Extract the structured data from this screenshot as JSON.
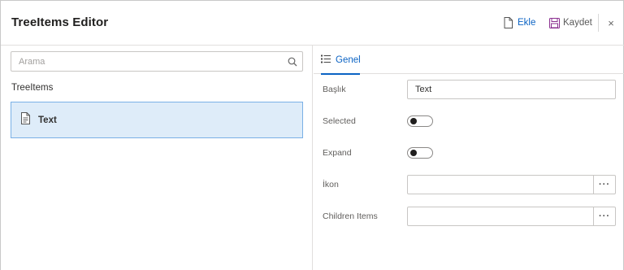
{
  "header": {
    "title": "TreeItems Editor",
    "add_label": "Ekle",
    "save_label": "Kaydet",
    "close_glyph": "×"
  },
  "left": {
    "search_placeholder": "Arama",
    "tree_title": "TreeItems",
    "items": [
      {
        "label": "Text",
        "icon": "document-icon",
        "selected": true
      }
    ]
  },
  "right": {
    "tab_label": "Genel",
    "fields": {
      "title_label": "Başlık",
      "title_value": "Text",
      "selected_label": "Selected",
      "selected_value": false,
      "expand_label": "Expand",
      "expand_value": false,
      "icon_label": "İkon",
      "icon_value": "",
      "children_label": "Children Items",
      "children_value": "",
      "picker_glyph": "···"
    }
  },
  "colors": {
    "accent": "#0b63c4",
    "selected_bg": "#deecf9",
    "selected_border": "#7ab0e6",
    "save_icon": "#8a2e8f"
  }
}
